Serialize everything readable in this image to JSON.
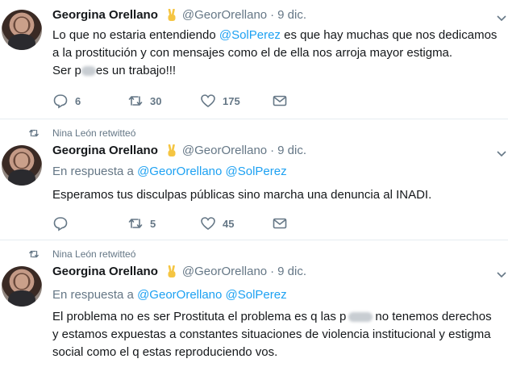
{
  "tweets": [
    {
      "retweeted_by": "",
      "author": {
        "name": "Georgina Orellano",
        "emoji": "✌",
        "handle": "@GeorOrellano",
        "date": "9 dic."
      },
      "text_parts": {
        "line1_a": "Lo que no estaria entendiendo ",
        "line1_mention": "@SolPerez",
        "line1_b": " es que hay muchas que nos dedicamos",
        "line2": "a la prostitución y con mensajes como el de ella nos arroja mayor estigma.",
        "line3_a": "Ser p",
        "line3_b": "es un trabajo!!!"
      },
      "counts": {
        "reply": "6",
        "retweet": "30",
        "like": "175"
      }
    },
    {
      "retweeted_by": "Nina León retwitteó",
      "author": {
        "name": "Georgina Orellano",
        "emoji": "✌",
        "handle": "@GeorOrellano",
        "date": "9 dic."
      },
      "reply_to": {
        "prefix": "En respuesta a",
        "users": "@GeorOrellano @SolPerez"
      },
      "text": "Esperamos tus disculpas públicas sino marcha una denuncia al INADI.",
      "counts": {
        "reply": "",
        "retweet": "5",
        "like": "45"
      }
    },
    {
      "retweeted_by": "Nina León retwitteó",
      "author": {
        "name": "Georgina Orellano",
        "emoji": "✌",
        "handle": "@GeorOrellano",
        "date": "9 dic."
      },
      "reply_to": {
        "prefix": "En respuesta a",
        "users": "@GeorOrellano @SolPerez"
      },
      "text_parts": {
        "line1_a": "El problema no es ser Prostituta el problema es q las p",
        "line1_b": "no tenemos derechos",
        "line2": "y estamos expuestas a constantes situaciones de violencia institucional y estigma",
        "line3": "social como el q estas reproduciendo vos."
      }
    }
  ],
  "header_separator": "·",
  "colors": {
    "link": "#1da1f2",
    "muted": "#657786",
    "divider": "#e6ecf0",
    "emoji": "#f5c542"
  },
  "icons": [
    "reply-icon",
    "retweet-icon",
    "like-icon",
    "message-icon",
    "caret-down-icon",
    "retweet-small-icon",
    "victory-hand-emoji"
  ]
}
